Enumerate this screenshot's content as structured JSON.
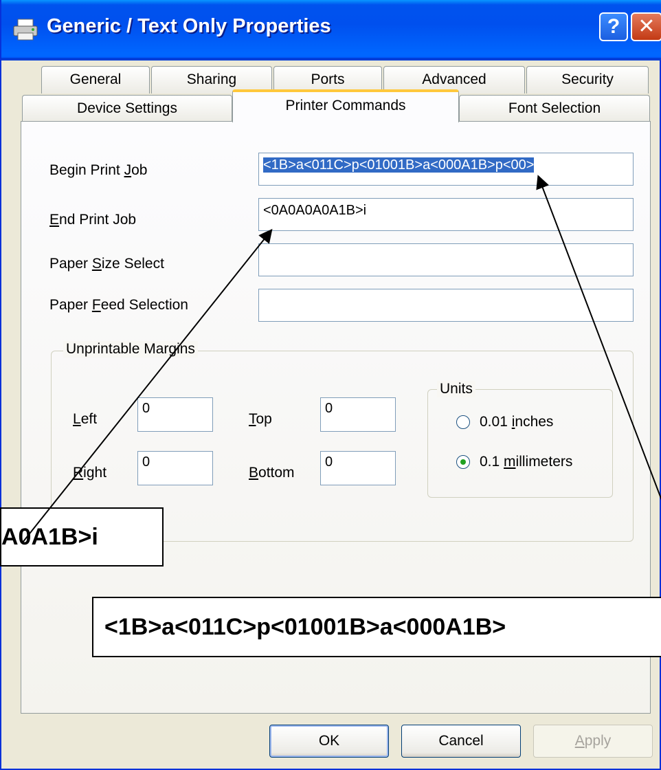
{
  "window": {
    "title": "Generic / Text Only Properties",
    "help_symbol": "?",
    "close_symbol": "✕"
  },
  "tabs_row1": [
    {
      "label": "General"
    },
    {
      "label": "Sharing"
    },
    {
      "label": "Ports"
    },
    {
      "label": "Advanced"
    },
    {
      "label": "Security"
    }
  ],
  "tabs_row2": [
    {
      "label": "Device Settings"
    },
    {
      "label": "Printer Commands"
    },
    {
      "label": "Font Selection"
    }
  ],
  "form": {
    "begin_label_pre": "Begin Print ",
    "begin_label_key": "J",
    "begin_label_post": "ob",
    "begin_value": "<1B>a<011C>p<01001B>a<000A1B>p<00>",
    "end_label_pre": "",
    "end_label_key": "E",
    "end_label_post": "nd Print Job",
    "end_value": "<0A0A0A0A1B>i",
    "paper_size_label_pre": "Paper ",
    "paper_size_label_key": "S",
    "paper_size_label_post": "ize Select",
    "paper_size_value": "",
    "paper_feed_label_pre": "Paper ",
    "paper_feed_label_key": "F",
    "paper_feed_label_post": "eed Selection",
    "paper_feed_value": ""
  },
  "margins": {
    "group_label": "Unprintable Margins",
    "left_key": "L",
    "left_rest": "eft",
    "left_value": "0",
    "top_key": "T",
    "top_rest": "op",
    "top_value": "0",
    "right_key": "R",
    "right_rest": "ight",
    "right_value": "0",
    "bottom_key": "B",
    "bottom_rest": "ottom",
    "bottom_value": "0"
  },
  "units": {
    "group_label": "Units",
    "opt1_pre": "0.01 ",
    "opt1_key": "i",
    "opt1_post": "nches",
    "opt2_pre": "0.1 ",
    "opt2_key": "m",
    "opt2_post": "illimeters",
    "selected": "0.1 millimeters"
  },
  "buttons": {
    "ok": "OK",
    "cancel": "Cancel",
    "apply_key": "A",
    "apply_rest": "pply"
  },
  "callouts": {
    "end_value": "A0A1B>i",
    "begin_value": "<1B>a<011C>p<01001B>a<000A1B>"
  },
  "colors": {
    "title_blue": "#0053ee",
    "selection": "#316ac5",
    "tab_highlight": "#ffc83c",
    "dialog_bg": "#ece9d8"
  }
}
